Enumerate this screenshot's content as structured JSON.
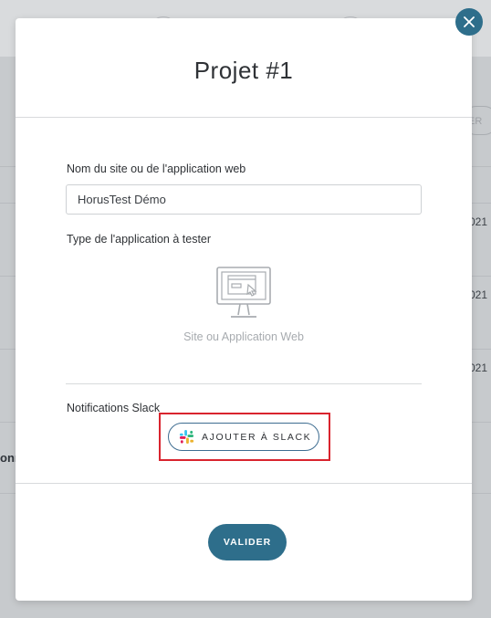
{
  "modal": {
    "title": "Projet #1",
    "site_name_label": "Nom du site ou de l'application web",
    "site_name_value": "HorusTest Démo",
    "app_type_label": "Type de l'application à tester",
    "app_type_option": "Site ou Application Web",
    "app_type_icon": "monitor-icon",
    "slack_section_label": "Notifications Slack",
    "slack_button_label": "AJOUTER À SLACK",
    "validate_label": "VALIDER",
    "close_icon": "close-icon"
  },
  "background": {
    "partial_year": "021",
    "partial_text": "onn",
    "partial_button": "ER"
  },
  "colors": {
    "accent": "#2e6e8b",
    "highlight": "#d9242e",
    "overlay": "#c9ccd0"
  }
}
